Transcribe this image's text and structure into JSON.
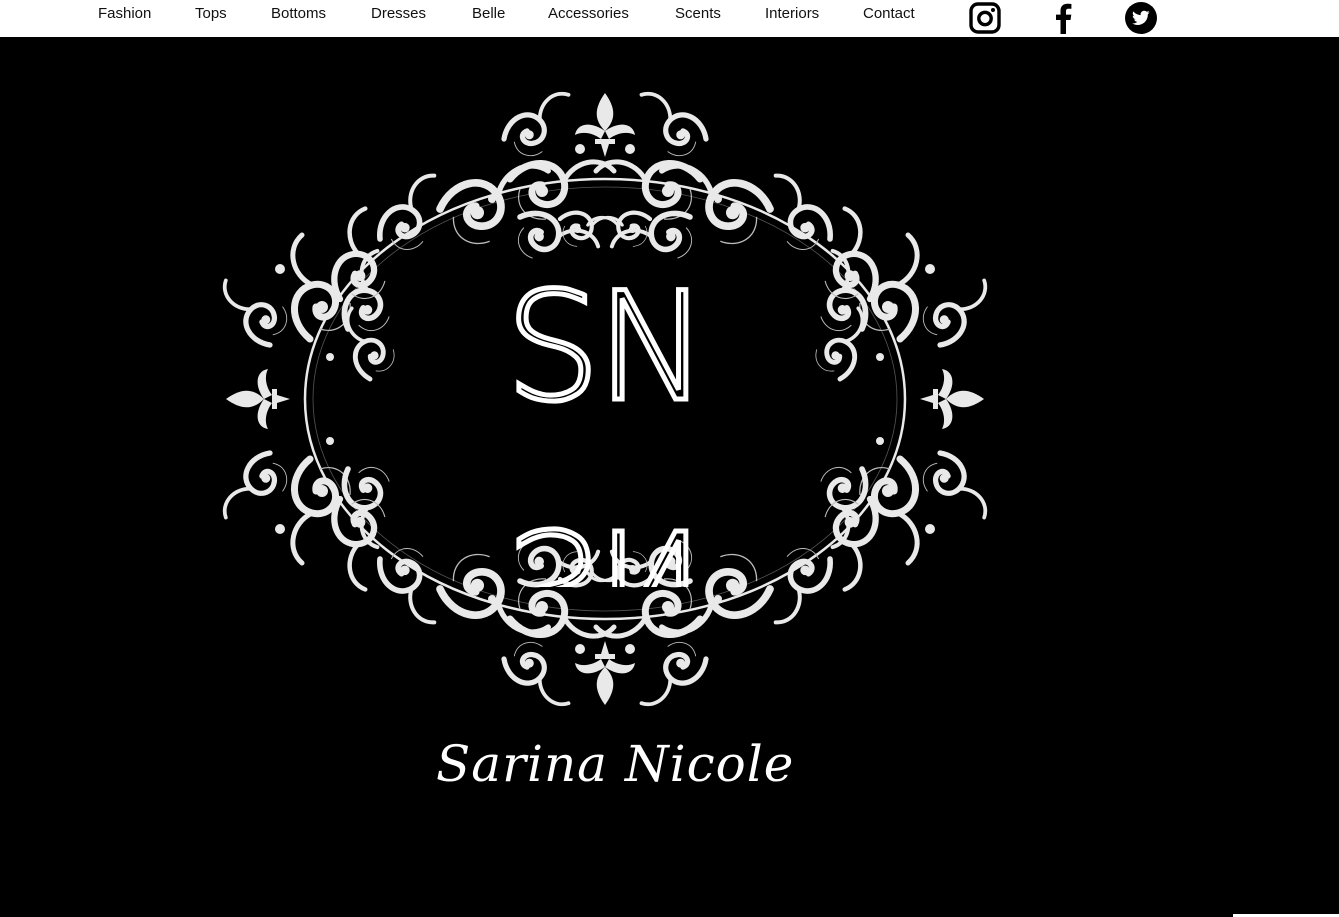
{
  "nav": {
    "links": [
      "Fashion",
      "Tops",
      "Bottoms",
      "Dresses",
      "Belle",
      "Accessories",
      "Scents",
      "Interiors",
      "Contact"
    ],
    "social": [
      {
        "icon": "instagram-icon"
      },
      {
        "icon": "facebook-icon"
      },
      {
        "icon": "twitter-icon"
      }
    ]
  },
  "hero": {
    "monogram_top": "SN",
    "monogram_bottom": "SN",
    "brand_name": "Sarina Nicole"
  },
  "colors": {
    "background": "#000000",
    "navbar": "#ffffff",
    "ornament": "#e9e9e9",
    "text": "#111111"
  }
}
